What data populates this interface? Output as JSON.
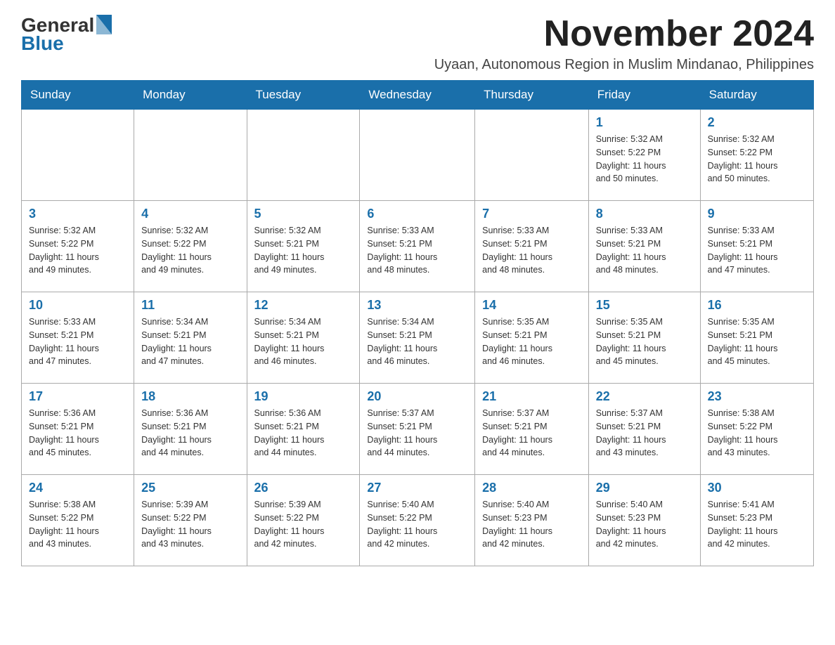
{
  "logo": {
    "general": "General",
    "blue": "Blue"
  },
  "title": "November 2024",
  "subtitle": "Uyaan, Autonomous Region in Muslim Mindanao, Philippines",
  "days_of_week": [
    "Sunday",
    "Monday",
    "Tuesday",
    "Wednesday",
    "Thursday",
    "Friday",
    "Saturday"
  ],
  "weeks": [
    [
      {
        "day": "",
        "info": ""
      },
      {
        "day": "",
        "info": ""
      },
      {
        "day": "",
        "info": ""
      },
      {
        "day": "",
        "info": ""
      },
      {
        "day": "",
        "info": ""
      },
      {
        "day": "1",
        "info": "Sunrise: 5:32 AM\nSunset: 5:22 PM\nDaylight: 11 hours\nand 50 minutes."
      },
      {
        "day": "2",
        "info": "Sunrise: 5:32 AM\nSunset: 5:22 PM\nDaylight: 11 hours\nand 50 minutes."
      }
    ],
    [
      {
        "day": "3",
        "info": "Sunrise: 5:32 AM\nSunset: 5:22 PM\nDaylight: 11 hours\nand 49 minutes."
      },
      {
        "day": "4",
        "info": "Sunrise: 5:32 AM\nSunset: 5:22 PM\nDaylight: 11 hours\nand 49 minutes."
      },
      {
        "day": "5",
        "info": "Sunrise: 5:32 AM\nSunset: 5:21 PM\nDaylight: 11 hours\nand 49 minutes."
      },
      {
        "day": "6",
        "info": "Sunrise: 5:33 AM\nSunset: 5:21 PM\nDaylight: 11 hours\nand 48 minutes."
      },
      {
        "day": "7",
        "info": "Sunrise: 5:33 AM\nSunset: 5:21 PM\nDaylight: 11 hours\nand 48 minutes."
      },
      {
        "day": "8",
        "info": "Sunrise: 5:33 AM\nSunset: 5:21 PM\nDaylight: 11 hours\nand 48 minutes."
      },
      {
        "day": "9",
        "info": "Sunrise: 5:33 AM\nSunset: 5:21 PM\nDaylight: 11 hours\nand 47 minutes."
      }
    ],
    [
      {
        "day": "10",
        "info": "Sunrise: 5:33 AM\nSunset: 5:21 PM\nDaylight: 11 hours\nand 47 minutes."
      },
      {
        "day": "11",
        "info": "Sunrise: 5:34 AM\nSunset: 5:21 PM\nDaylight: 11 hours\nand 47 minutes."
      },
      {
        "day": "12",
        "info": "Sunrise: 5:34 AM\nSunset: 5:21 PM\nDaylight: 11 hours\nand 46 minutes."
      },
      {
        "day": "13",
        "info": "Sunrise: 5:34 AM\nSunset: 5:21 PM\nDaylight: 11 hours\nand 46 minutes."
      },
      {
        "day": "14",
        "info": "Sunrise: 5:35 AM\nSunset: 5:21 PM\nDaylight: 11 hours\nand 46 minutes."
      },
      {
        "day": "15",
        "info": "Sunrise: 5:35 AM\nSunset: 5:21 PM\nDaylight: 11 hours\nand 45 minutes."
      },
      {
        "day": "16",
        "info": "Sunrise: 5:35 AM\nSunset: 5:21 PM\nDaylight: 11 hours\nand 45 minutes."
      }
    ],
    [
      {
        "day": "17",
        "info": "Sunrise: 5:36 AM\nSunset: 5:21 PM\nDaylight: 11 hours\nand 45 minutes."
      },
      {
        "day": "18",
        "info": "Sunrise: 5:36 AM\nSunset: 5:21 PM\nDaylight: 11 hours\nand 44 minutes."
      },
      {
        "day": "19",
        "info": "Sunrise: 5:36 AM\nSunset: 5:21 PM\nDaylight: 11 hours\nand 44 minutes."
      },
      {
        "day": "20",
        "info": "Sunrise: 5:37 AM\nSunset: 5:21 PM\nDaylight: 11 hours\nand 44 minutes."
      },
      {
        "day": "21",
        "info": "Sunrise: 5:37 AM\nSunset: 5:21 PM\nDaylight: 11 hours\nand 44 minutes."
      },
      {
        "day": "22",
        "info": "Sunrise: 5:37 AM\nSunset: 5:21 PM\nDaylight: 11 hours\nand 43 minutes."
      },
      {
        "day": "23",
        "info": "Sunrise: 5:38 AM\nSunset: 5:22 PM\nDaylight: 11 hours\nand 43 minutes."
      }
    ],
    [
      {
        "day": "24",
        "info": "Sunrise: 5:38 AM\nSunset: 5:22 PM\nDaylight: 11 hours\nand 43 minutes."
      },
      {
        "day": "25",
        "info": "Sunrise: 5:39 AM\nSunset: 5:22 PM\nDaylight: 11 hours\nand 43 minutes."
      },
      {
        "day": "26",
        "info": "Sunrise: 5:39 AM\nSunset: 5:22 PM\nDaylight: 11 hours\nand 42 minutes."
      },
      {
        "day": "27",
        "info": "Sunrise: 5:40 AM\nSunset: 5:22 PM\nDaylight: 11 hours\nand 42 minutes."
      },
      {
        "day": "28",
        "info": "Sunrise: 5:40 AM\nSunset: 5:23 PM\nDaylight: 11 hours\nand 42 minutes."
      },
      {
        "day": "29",
        "info": "Sunrise: 5:40 AM\nSunset: 5:23 PM\nDaylight: 11 hours\nand 42 minutes."
      },
      {
        "day": "30",
        "info": "Sunrise: 5:41 AM\nSunset: 5:23 PM\nDaylight: 11 hours\nand 42 minutes."
      }
    ]
  ]
}
